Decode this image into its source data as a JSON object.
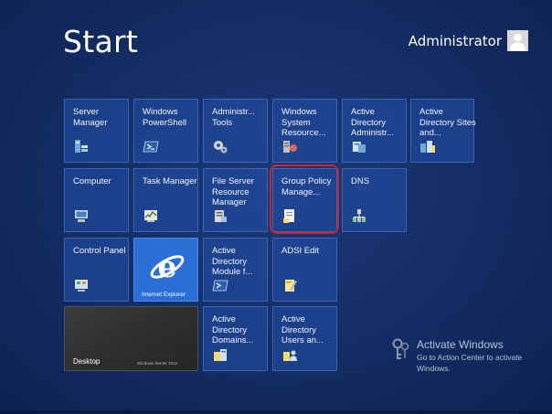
{
  "header": {
    "title": "Start",
    "user_name": "Administrator"
  },
  "tiles": [
    {
      "label": "Server Manager",
      "icon": "server-manager-icon"
    },
    {
      "label": "Windows PowerShell",
      "icon": "powershell-icon"
    },
    {
      "label": "Administr... Tools",
      "icon": "admin-tools-icon"
    },
    {
      "label": "Windows System Resource...",
      "icon": "system-resource-icon"
    },
    {
      "label": "Active Directory Administr...",
      "icon": "ad-admin-center-icon"
    },
    {
      "label": "Active Directory Sites and...",
      "icon": "ad-sites-icon"
    },
    {
      "label": "Computer",
      "icon": "computer-icon"
    },
    {
      "label": "Task Manager",
      "icon": "task-manager-icon"
    },
    {
      "label": "File Server Resource Manager",
      "icon": "file-server-icon"
    },
    {
      "label": "Group Policy Manage...",
      "icon": "group-policy-icon"
    },
    {
      "label": "DNS",
      "icon": "dns-icon"
    },
    {
      "label": "Control Panel",
      "icon": "control-panel-icon"
    },
    {
      "label": "Internet Explorer",
      "icon": "internet-explorer-icon"
    },
    {
      "label": "Active Directory Module f...",
      "icon": "ad-module-icon"
    },
    {
      "label": "ADSI Edit",
      "icon": "adsi-edit-icon"
    },
    {
      "label": "Desktop",
      "icon": "desktop-icon"
    },
    {
      "label": "Active Directory Domains...",
      "icon": "ad-domains-icon"
    },
    {
      "label": "Active Directory Users an...",
      "icon": "ad-users-icon"
    }
  ],
  "desktop_brand": "Windows Server 2012",
  "watermark": {
    "title": "Activate Windows",
    "subtitle": "Go to Action Center to activate Windows."
  },
  "colors": {
    "background": "#132c63",
    "tile": "#2350aa",
    "ie_tile": "#2a6fd6",
    "highlight": "#d0202a"
  }
}
